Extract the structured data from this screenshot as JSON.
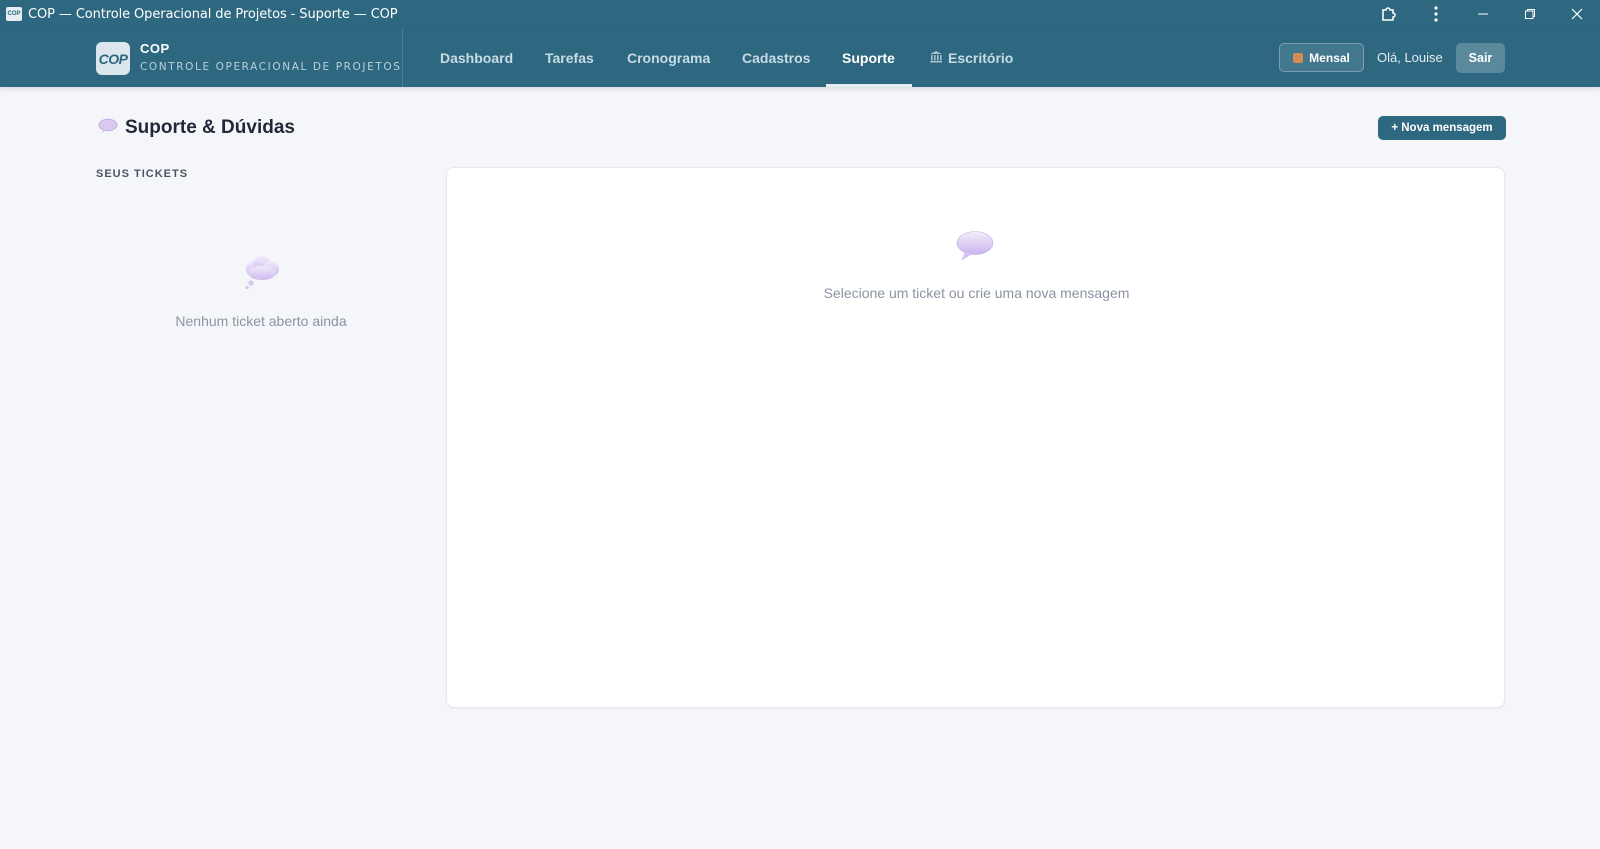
{
  "window": {
    "title": "COP — Controle Operacional de Projetos - Suporte — COP",
    "favicon_text": "COP"
  },
  "brand": {
    "logo_text": "COP",
    "title": "COP",
    "subtitle": "CONTROLE OPERACIONAL DE PROJETOS"
  },
  "nav": {
    "tabs": [
      {
        "label": "Dashboard"
      },
      {
        "label": "Tarefas"
      },
      {
        "label": "Cronograma"
      },
      {
        "label": "Cadastros"
      },
      {
        "label": "Suporte",
        "active": true
      },
      {
        "label": "Escritório",
        "icon": "bank-icon"
      }
    ]
  },
  "user": {
    "plan_label": "Mensal",
    "plan_icon": "box-icon",
    "greeting": "Olá, Louise",
    "logout_label": "Sair"
  },
  "page": {
    "title": "Suporte & Dúvidas",
    "title_icon": "speech-bubble-icon",
    "new_message_label": "+ Nova mensagem"
  },
  "tickets": {
    "heading": "SEUS TICKETS",
    "empty_icon": "thought-bubble-icon",
    "empty_text": "Nenhum ticket aberto ainda"
  },
  "panel": {
    "icon": "speech-bubble-icon",
    "placeholder_text": "Selecione um ticket ou crie uma nova mensagem"
  },
  "colors": {
    "primary": "#2d6880",
    "background": "#f5f6f9",
    "muted_text": "#8a94a3",
    "bubble": "#d9c9f1"
  }
}
